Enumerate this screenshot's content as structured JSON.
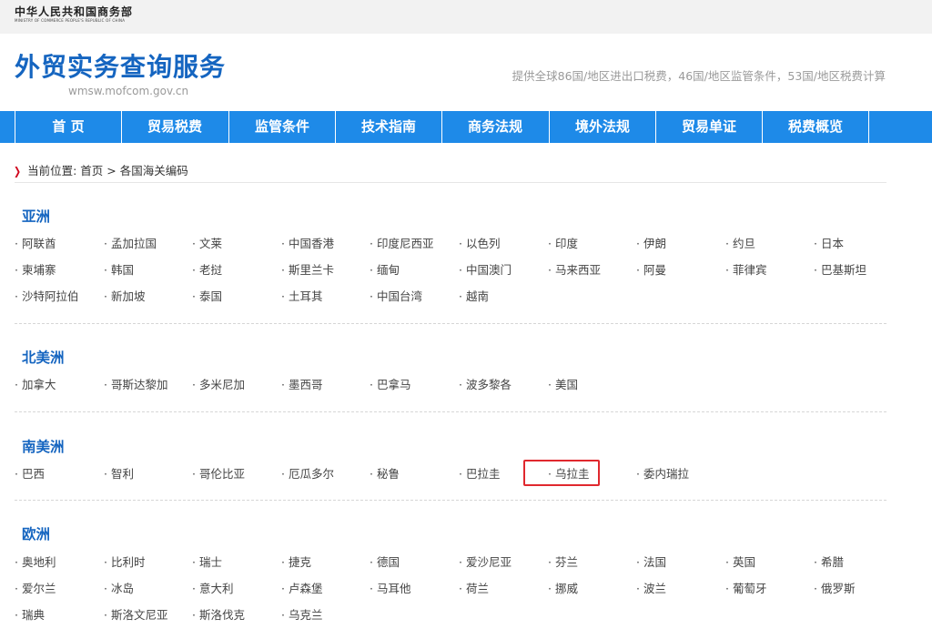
{
  "header": {
    "ministry_cn": "中华人民共和国商务部",
    "ministry_en": "MINISTRY OF COMMERCE PEOPLE'S REPUBLIC OF CHINA",
    "site_title": "外贸实务查询服务",
    "site_url": "wmsw.mofcom.gov.cn",
    "tagline": "提供全球86国/地区进出口税费，46国/地区监管条件，53国/地区税费计算"
  },
  "nav": {
    "items": [
      "首 页",
      "贸易税费",
      "监管条件",
      "技术指南",
      "商务法规",
      "境外法规",
      "贸易单证",
      "税费概览"
    ]
  },
  "breadcrumb": {
    "prefix": "当前位置:",
    "home": "首页",
    "separator": ">",
    "current": "各国海关编码"
  },
  "regions": [
    {
      "name": "亚洲",
      "countries": [
        "阿联酋",
        "孟加拉国",
        "文莱",
        "中国香港",
        "印度尼西亚",
        "以色列",
        "印度",
        "伊朗",
        "约旦",
        "日本",
        "柬埔寨",
        "韩国",
        "老挝",
        "斯里兰卡",
        "缅甸",
        "中国澳门",
        "马来西亚",
        "阿曼",
        "菲律宾",
        "巴基斯坦",
        "沙特阿拉伯",
        "新加坡",
        "泰国",
        "土耳其",
        "中国台湾",
        "越南"
      ]
    },
    {
      "name": "北美洲",
      "countries": [
        "加拿大",
        "哥斯达黎加",
        "多米尼加",
        "墨西哥",
        "巴拿马",
        "波多黎各",
        "美国"
      ]
    },
    {
      "name": "南美洲",
      "countries": [
        "巴西",
        "智利",
        "哥伦比亚",
        "厄瓜多尔",
        "秘鲁",
        "巴拉圭",
        "乌拉圭",
        "委内瑞拉"
      ]
    },
    {
      "name": "欧洲",
      "countries": [
        "奥地利",
        "比利时",
        "瑞士",
        "捷克",
        "德国",
        "爱沙尼亚",
        "芬兰",
        "法国",
        "英国",
        "希腊",
        "爱尔兰",
        "冰岛",
        "意大利",
        "卢森堡",
        "马耳他",
        "荷兰",
        "挪威",
        "波兰",
        "葡萄牙",
        "俄罗斯",
        "瑞典",
        "斯洛文尼亚",
        "斯洛伐克",
        "乌克兰"
      ]
    }
  ],
  "list_bullet": "·",
  "highlighted_country": "乌拉圭",
  "colors": {
    "brand_blue": "#1565c0",
    "nav_blue": "#1e8ae8",
    "highlight_red": "#e0282e",
    "crumb_arrow": "#d0021b"
  }
}
